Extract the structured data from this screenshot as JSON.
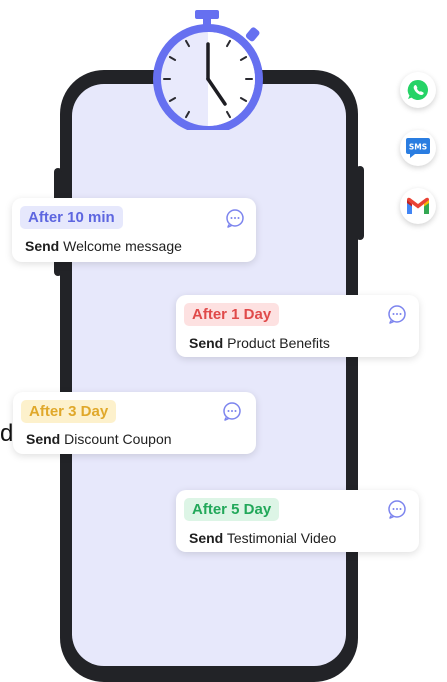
{
  "cards": [
    {
      "delay": "After 10 min",
      "action": "Send",
      "message": "Welcome message",
      "tag_bg": "#e6e8fc",
      "tag_color": "#5d66e0"
    },
    {
      "delay": "After 1 Day",
      "action": "Send",
      "message": "Product Benefits",
      "tag_bg": "#fde1e1",
      "tag_color": "#e04a4a"
    },
    {
      "delay": "After 3 Day",
      "action": "Send",
      "message": "Discount Coupon",
      "tag_bg": "#fdf1cc",
      "tag_color": "#e0a82a"
    },
    {
      "delay": "After 5 Day",
      "action": "Send",
      "message": "Testimonial Video",
      "tag_bg": "#ddf5e6",
      "tag_color": "#22a85a"
    }
  ],
  "channels": {
    "whatsapp": {
      "icon": "whatsapp-icon",
      "color": "#25d366"
    },
    "sms": {
      "icon": "sms-icon",
      "label": "SMS",
      "color": "#2a7de1"
    },
    "gmail": {
      "icon": "gmail-icon"
    }
  },
  "stray_text": "d",
  "colors": {
    "accent": "#6670f0",
    "phone": "#222327",
    "screen": "#e7e8fb"
  }
}
